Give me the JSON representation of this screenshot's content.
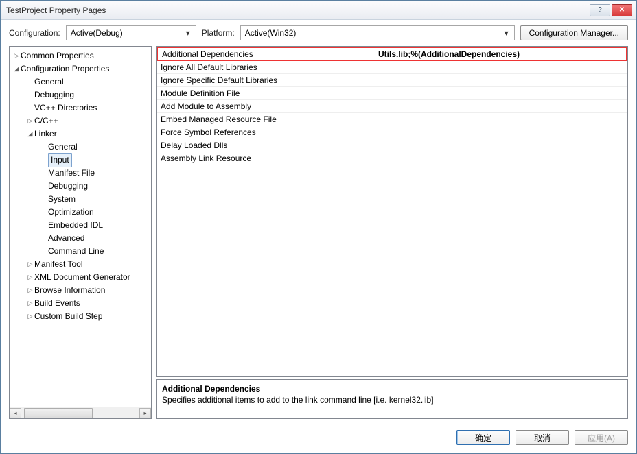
{
  "window": {
    "title": "TestProject Property Pages"
  },
  "topbar": {
    "configLabel": "Configuration:",
    "configValue": "Active(Debug)",
    "platformLabel": "Platform:",
    "platformValue": "Active(Win32)",
    "managerBtn": "Configuration Manager..."
  },
  "tree": {
    "n0": "Common Properties",
    "n1": "Configuration Properties",
    "n1_0": "General",
    "n1_1": "Debugging",
    "n1_2": "VC++ Directories",
    "n1_3": "C/C++",
    "n1_4": "Linker",
    "n1_4_0": "General",
    "n1_4_1": "Input",
    "n1_4_2": "Manifest File",
    "n1_4_3": "Debugging",
    "n1_4_4": "System",
    "n1_4_5": "Optimization",
    "n1_4_6": "Embedded IDL",
    "n1_4_7": "Advanced",
    "n1_4_8": "Command Line",
    "n1_5": "Manifest Tool",
    "n1_6": "XML Document Generator",
    "n1_7": "Browse Information",
    "n1_8": "Build Events",
    "n1_9": "Custom Build Step"
  },
  "props": {
    "rows": [
      {
        "name": "Additional Dependencies",
        "value": "Utils.lib;%(AdditionalDependencies)"
      },
      {
        "name": "Ignore All Default Libraries",
        "value": ""
      },
      {
        "name": "Ignore Specific Default Libraries",
        "value": ""
      },
      {
        "name": "Module Definition File",
        "value": ""
      },
      {
        "name": "Add Module to Assembly",
        "value": ""
      },
      {
        "name": "Embed Managed Resource File",
        "value": ""
      },
      {
        "name": "Force Symbol References",
        "value": ""
      },
      {
        "name": "Delay Loaded Dlls",
        "value": ""
      },
      {
        "name": "Assembly Link Resource",
        "value": ""
      }
    ]
  },
  "desc": {
    "title": "Additional Dependencies",
    "text": "Specifies additional items to add to the link command line [i.e. kernel32.lib]"
  },
  "footer": {
    "ok": "确定",
    "cancel": "取消",
    "apply": "应用(A)"
  }
}
